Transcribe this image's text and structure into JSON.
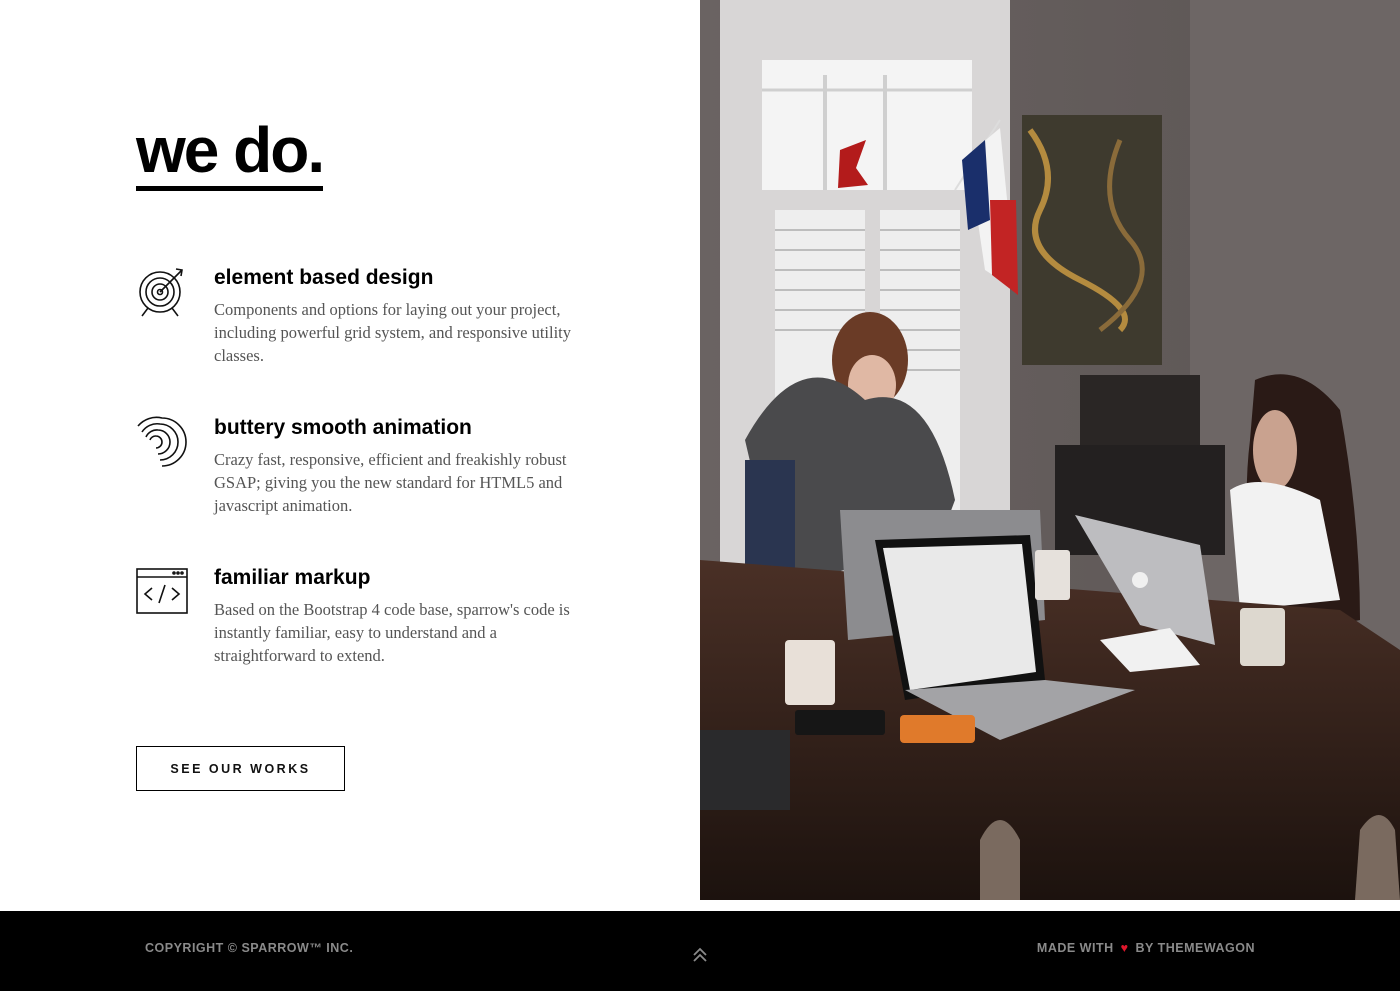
{
  "section": {
    "heading": "we do.",
    "features": [
      {
        "icon": "target-icon",
        "title": "element based design",
        "description": "Components and options for laying out your project, including powerful grid system, and responsive utility classes."
      },
      {
        "icon": "animation-swirl-icon",
        "title": "buttery smooth animation",
        "description": "Crazy fast, responsive, efficient and freakishly robust GSAP; giving you the new standard for HTML5 and javascript animation."
      },
      {
        "icon": "code-window-icon",
        "title": "familiar markup",
        "description": "Based on the Bootstrap 4 code base, sparrow's code is instantly familiar, easy to understand and a straightforward to extend."
      }
    ],
    "cta_label": "SEE OUR WORKS"
  },
  "photo": {
    "subject": "photo-of-people-working-on-laptops"
  },
  "footer": {
    "copyright": "COPYRIGHT © SPARROW™ INC.",
    "made_with_prefix": "MADE WITH",
    "heart": "♥",
    "made_with_suffix": "BY THEMEWAGON",
    "back_to_top_icon": "double-chevron-up-icon"
  },
  "colors": {
    "accent_heart": "#e0162b",
    "footer_bg": "#000000",
    "footer_text": "#8a8a8a"
  }
}
